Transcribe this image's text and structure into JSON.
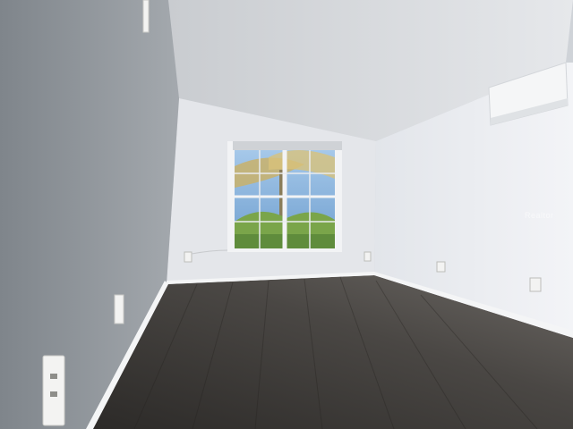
{
  "scene": {
    "description_free": true,
    "colors": {
      "left_wall": "#8e9398",
      "back_wall": "#e6e8ec",
      "right_wall": "#eceef2",
      "ceiling": "#d9dce0",
      "floor_dark": "#2f2e2c",
      "floor_light": "#6e6a66",
      "baseboard": "#f4f5f6",
      "window_frame": "#f2f3f5",
      "sky": "#8fb8e0",
      "foliage": "#7aa54a",
      "ac_unit": "#f5f6f7"
    }
  },
  "watermark": {
    "text": "Realtor"
  }
}
